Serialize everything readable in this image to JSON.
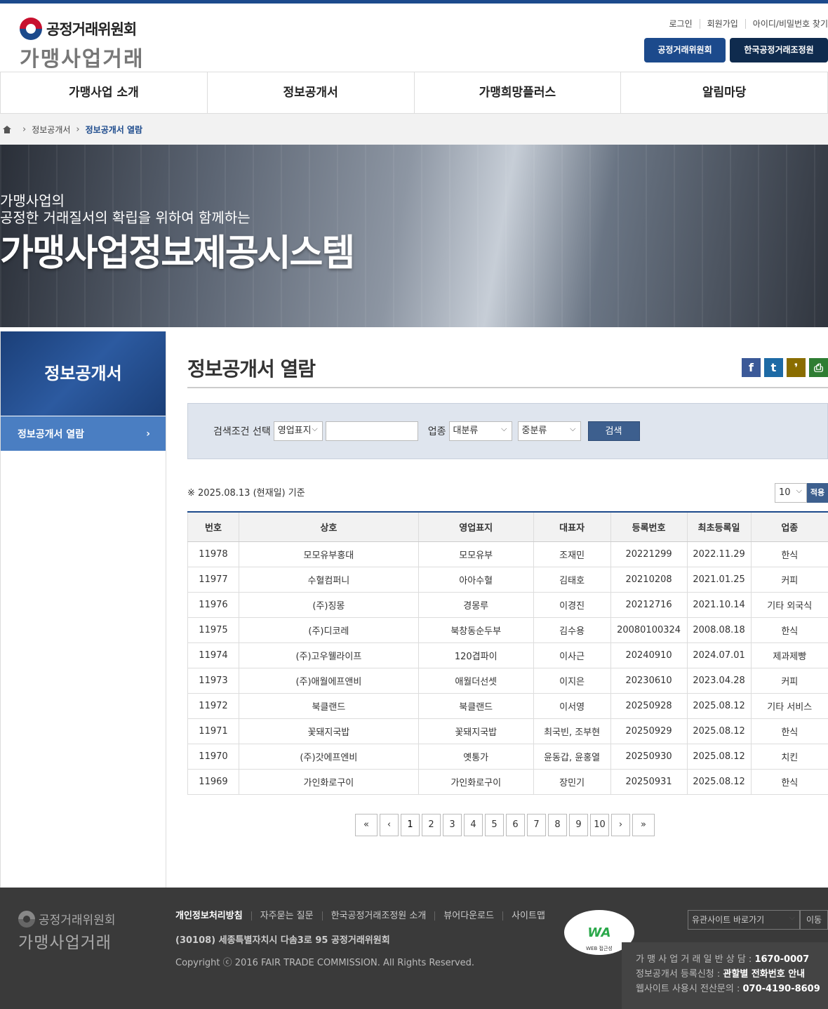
{
  "header": {
    "org_name": "공정거래위원회",
    "sub_name": "가맹사업거래",
    "util_links": [
      "로그인",
      "회원가입",
      "아이디/비밀번호 찾기"
    ],
    "org_buttons": [
      "공정거래위원회",
      "한국공정거래조정원"
    ]
  },
  "gnb": [
    "가맹사업 소개",
    "정보공개서",
    "가맹희망플러스",
    "알림마당"
  ],
  "breadcrumb": {
    "level1": "정보공개서",
    "current": "정보공개서 열람"
  },
  "visual": {
    "line1": "가맹사업의",
    "line2": "공정한 거래질서의 확립을 위하여 함께하는",
    "headline": "가맹사업정보제공시스템"
  },
  "lnb": {
    "title": "정보공개서",
    "item": "정보공개서 열람"
  },
  "page": {
    "title": "정보공개서 열람",
    "sns": [
      {
        "label": "f",
        "color": "#3b5998"
      },
      {
        "label": "t",
        "color": "#1d6aa5"
      },
      {
        "label": "❜",
        "color": "#8a6d00"
      },
      {
        "label": "⎙",
        "color": "#2e7d32"
      }
    ]
  },
  "search": {
    "condition_label": "검색조건 선택",
    "condition_value": "영업표지",
    "keyword": "",
    "industry_label": "업종",
    "major_value": "대분류",
    "minor_value": "중분류",
    "button": "검색"
  },
  "list": {
    "basis": "※ 2025.08.13 (현재일) 기준",
    "per_page": "10",
    "apply": "적용",
    "columns": [
      "번호",
      "상호",
      "영업표지",
      "대표자",
      "등록번호",
      "최초등록일",
      "업종"
    ],
    "rows": [
      [
        "11978",
        "모모유부홍대",
        "모모유부",
        "조재민",
        "20221299",
        "2022.11.29",
        "한식"
      ],
      [
        "11977",
        "수혈컴퍼니",
        "아아수혈",
        "김태호",
        "20210208",
        "2021.01.25",
        "커피"
      ],
      [
        "11976",
        "(주)징몽",
        "경몽루",
        "이경진",
        "20212716",
        "2021.10.14",
        "기타 외국식"
      ],
      [
        "11975",
        "(주)디코레",
        "북창동순두부",
        "김수용",
        "20080100324",
        "2008.08.18",
        "한식"
      ],
      [
        "11974",
        "(주)고우웰라이프",
        "120겹파이",
        "이사근",
        "20240910",
        "2024.07.01",
        "제과제빵"
      ],
      [
        "11973",
        "(주)애월에프앤비",
        "애월더선셋",
        "이지은",
        "20230610",
        "2023.04.28",
        "커피"
      ],
      [
        "11972",
        "북클랜드",
        "북클랜드",
        "이서영",
        "20250928",
        "2025.08.12",
        "기타 서비스"
      ],
      [
        "11971",
        "꽃돼지국밥",
        "꽃돼지국밥",
        "최국빈, 조부현",
        "20250929",
        "2025.08.12",
        "한식"
      ],
      [
        "11970",
        "(주)갓에프엔비",
        "옛통가",
        "윤동갑, 윤홍열",
        "20250930",
        "2025.08.12",
        "치킨"
      ],
      [
        "11969",
        "가인화로구이",
        "가인화로구이",
        "장민기",
        "20250931",
        "2025.08.12",
        "한식"
      ]
    ]
  },
  "paging": {
    "first": "«",
    "prev": "‹",
    "pages": [
      "1",
      "2",
      "3",
      "4",
      "5",
      "6",
      "7",
      "8",
      "9",
      "10"
    ],
    "current": "1",
    "next": "›",
    "last": "»"
  },
  "footer": {
    "org_name": "공정거래위원회",
    "sub_name": "가맹사업거래",
    "links": [
      "개인정보처리방침",
      "자주묻는 질문",
      "한국공정거래조정원 소개",
      "뷰어다운로드",
      "사이트맵"
    ],
    "address": "(30108) 세종특별자치시 다솜3로 95 공정거래위원회",
    "copyright": "Copyright ⓒ 2016 FAIR TRADE COMMISSION. All Rights Reserved.",
    "wa_label": "WA",
    "wa_caption": "WEB 접근성",
    "family_site": "유관사이트 바로가기",
    "family_go": "이동",
    "contacts": [
      {
        "label": "가 맹 사 업 거 래 일 반 상 담 :",
        "value": "1670-0007"
      },
      {
        "label": "정보공개서 등록신청 :",
        "value": "관할별 전화번호 안내"
      },
      {
        "label": "웹사이트 사용시 전산문의 :",
        "value": "070-4190-8609"
      }
    ]
  }
}
